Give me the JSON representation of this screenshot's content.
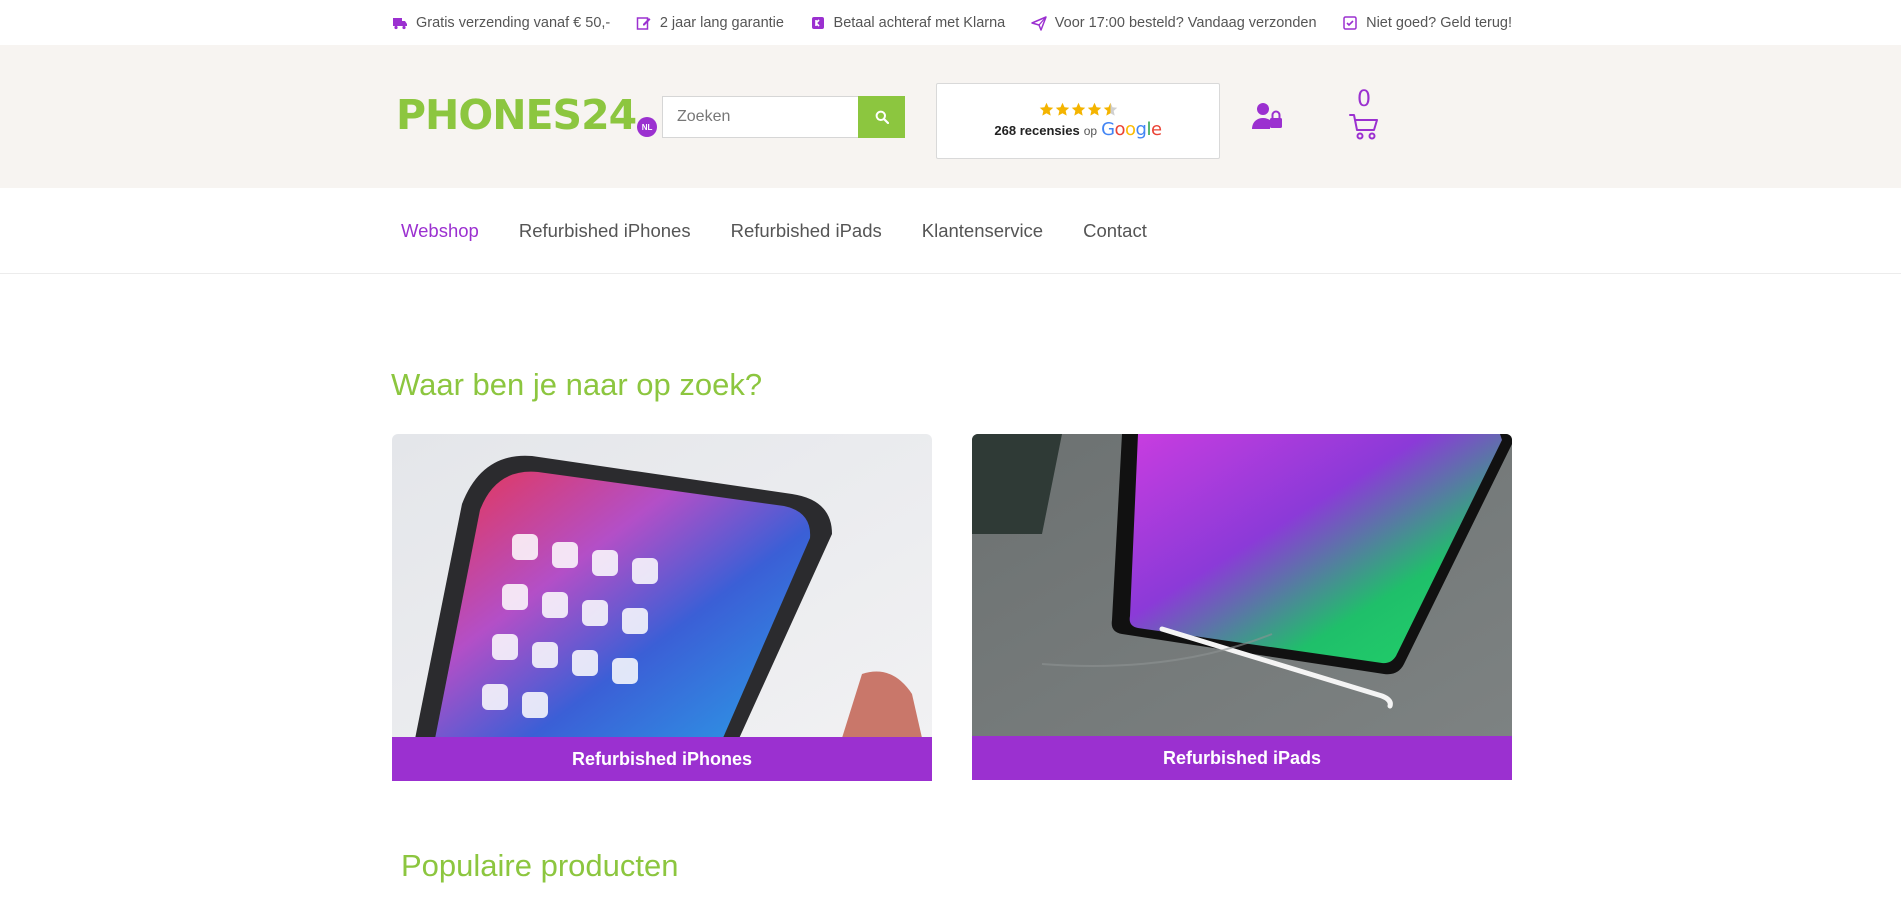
{
  "usps": [
    {
      "icon": "truck-icon",
      "text": "Gratis verzending vanaf € 50,-"
    },
    {
      "icon": "edit-icon",
      "text": "2 jaar lang garantie"
    },
    {
      "icon": "klarna-icon",
      "text": "Betaal achteraf met Klarna"
    },
    {
      "icon": "send-icon",
      "text": "Voor 17:00 besteld? Vandaag verzonden"
    },
    {
      "icon": "check-square-icon",
      "text": "Niet goed? Geld terug!"
    }
  ],
  "header": {
    "logo_text": "PHONES24",
    "logo_badge": "NL",
    "search_placeholder": "Zoeken",
    "reviews": {
      "rating": 4.5,
      "count_text": "268 recensies",
      "op_text": "op",
      "provider": "Google"
    },
    "cart_count": "0"
  },
  "nav": {
    "items": [
      {
        "label": "Webshop",
        "active": true
      },
      {
        "label": "Refurbished iPhones",
        "active": false
      },
      {
        "label": "Refurbished iPads",
        "active": false
      },
      {
        "label": "Klantenservice",
        "active": false
      },
      {
        "label": "Contact",
        "active": false
      }
    ]
  },
  "main": {
    "categories_title": "Waar ben je naar op zoek?",
    "categories": [
      {
        "label": "Refurbished iPhones"
      },
      {
        "label": "Refurbished iPads"
      }
    ],
    "popular_title": "Populaire producten"
  },
  "colors": {
    "brand_green": "#8cc63f",
    "brand_purple": "#9b30d0",
    "header_bg": "#f7f4f1"
  }
}
